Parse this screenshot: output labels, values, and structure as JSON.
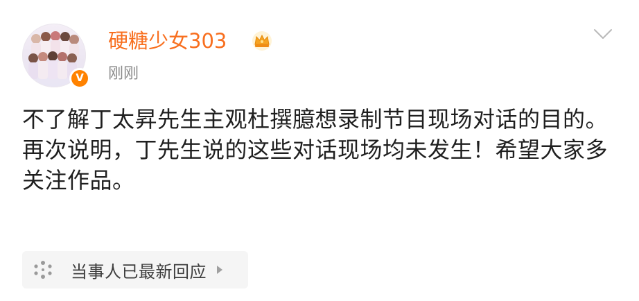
{
  "post": {
    "author": {
      "name": "硬糖少女303",
      "verified_badge_letter": "V",
      "crown_icon": "crown-icon",
      "name_color": "#f86f1f"
    },
    "timestamp": "刚刚",
    "more_icon": "chevron-down-icon",
    "body": {
      "paragraph_1": "不了解丁太昇先生主观杜撰臆想录制节目现场对话的目的。",
      "paragraph_2": "再次说明，丁先生说的这些对话现场均未发生！希望大家多关注作品。"
    },
    "response_chip": {
      "label": "当事人已最新回应",
      "icon": "spark-icon",
      "arrow": "triangle-right-icon"
    }
  },
  "colors": {
    "accent": "#f86f1f",
    "verified": "#ff8200",
    "text": "#1f1f1f",
    "muted": "#8a8a8a",
    "chip_bg": "#f5f5f5"
  }
}
